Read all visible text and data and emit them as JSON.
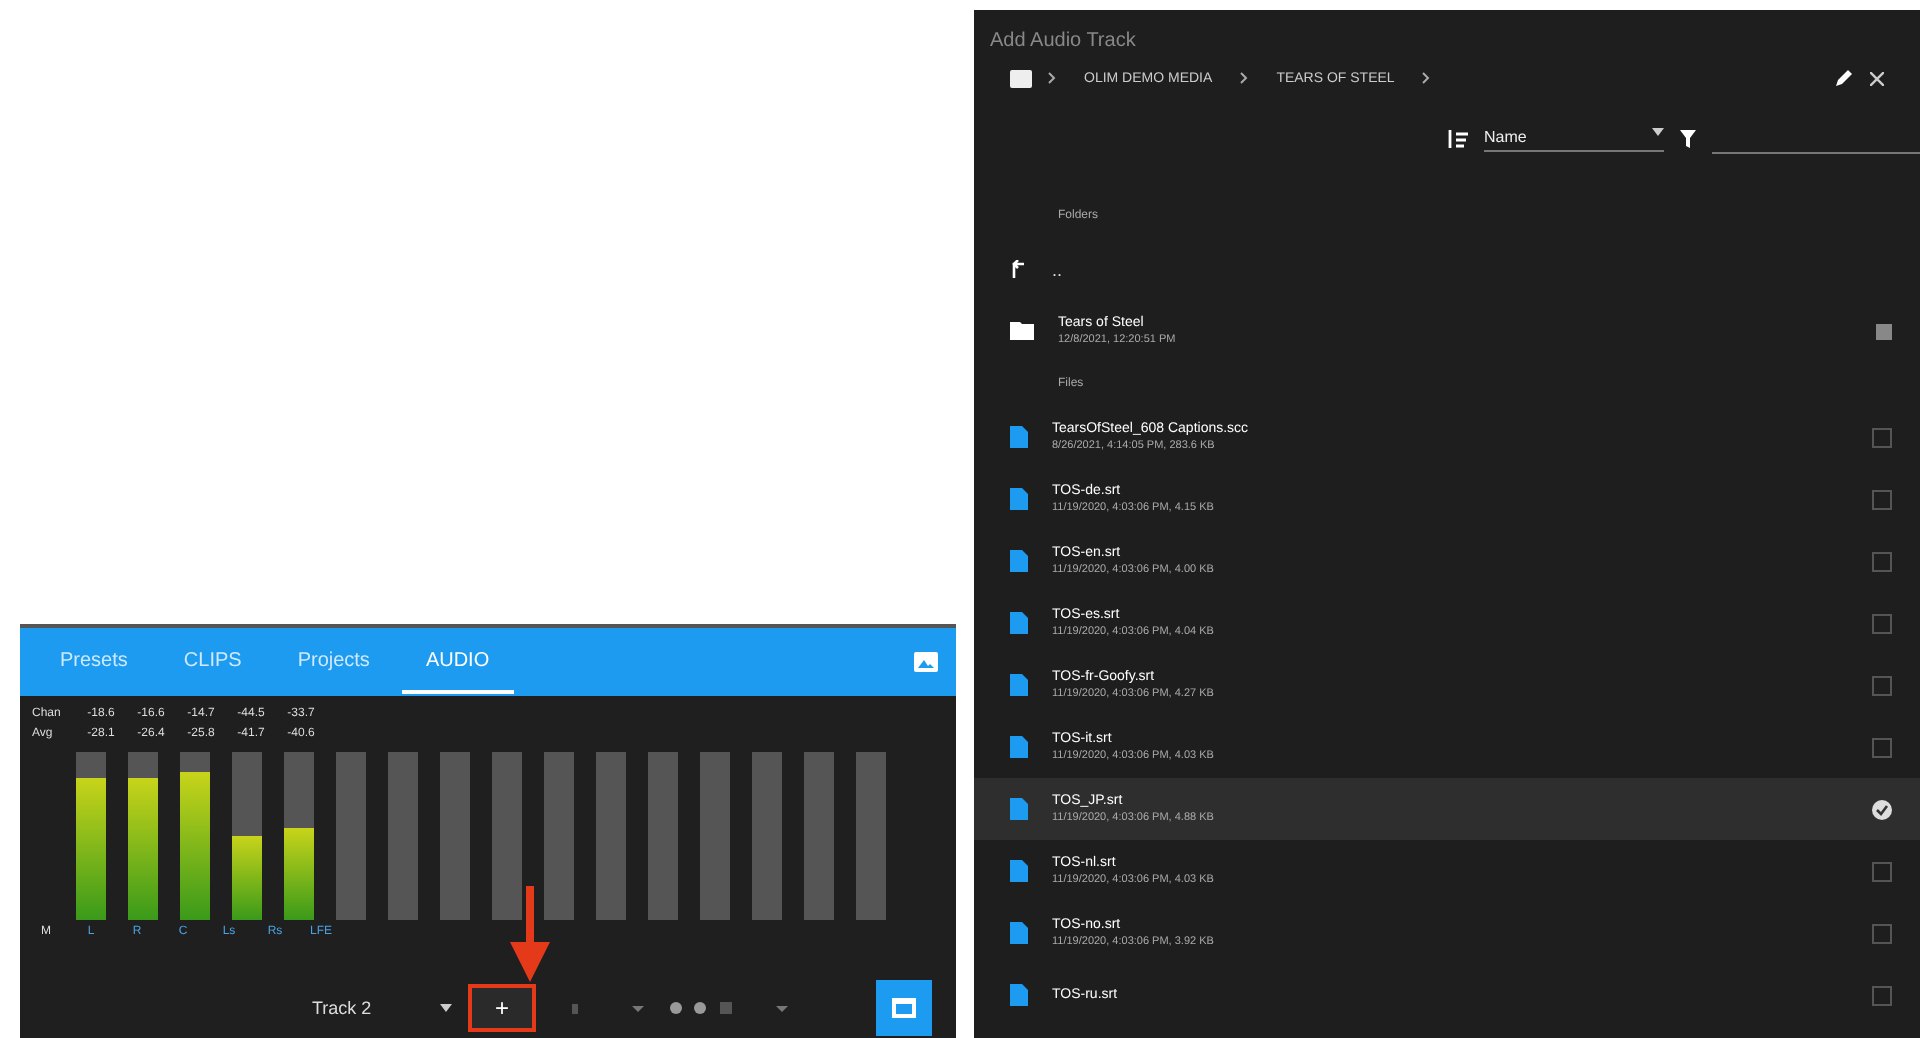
{
  "mixer": {
    "tabs": [
      {
        "label": "Presets",
        "selected": false
      },
      {
        "label": "CLIPS",
        "selected": false
      },
      {
        "label": "Projects",
        "selected": false
      },
      {
        "label": "AUDIO",
        "selected": true
      }
    ],
    "readouts": [
      {
        "label": "Chan",
        "values": [
          "-18.6",
          "-16.6",
          "-14.7",
          "-44.5",
          "-33.7"
        ]
      },
      {
        "label": "Avg",
        "values": [
          "-28.1",
          "-26.4",
          "-25.8",
          "-41.7",
          "-40.6"
        ]
      }
    ],
    "scale_label": "M",
    "meters": [
      {
        "kind": "active",
        "label": "L",
        "level": 0.85
      },
      {
        "kind": "active",
        "label": "R",
        "level": 0.85
      },
      {
        "kind": "active",
        "label": "C",
        "level": 0.88
      },
      {
        "kind": "active",
        "label": "Ls",
        "level": 0.5
      },
      {
        "kind": "active",
        "label": "Rs",
        "level": 0.55
      },
      {
        "kind": "inactive",
        "label": "LFE"
      },
      {
        "kind": "inactive"
      },
      {
        "kind": "inactive"
      },
      {
        "kind": "inactive"
      },
      {
        "kind": "inactive"
      },
      {
        "kind": "inactive"
      },
      {
        "kind": "inactive"
      },
      {
        "kind": "inactive"
      },
      {
        "kind": "inactive"
      },
      {
        "kind": "inactive"
      },
      {
        "kind": "inactive"
      }
    ],
    "track_select": "Track 2",
    "add_button": "+"
  },
  "dialog": {
    "title": "Add Audio Track",
    "breadcrumbs": [
      "OLIM DEMO MEDIA",
      "TEARS OF STEEL"
    ],
    "sort": "Name",
    "folders_heading": "Folders",
    "up_item": "..",
    "folders": [
      {
        "name": "Tears of Steel",
        "meta": "12/8/2021, 12:20:51 PM"
      }
    ],
    "files_heading": "Files",
    "files": [
      {
        "name": "TearsOfSteel_608 Captions.scc",
        "meta": "8/26/2021, 4:14:05 PM, 283.6 KB",
        "checked": false
      },
      {
        "name": "TOS-de.srt",
        "meta": "11/19/2020, 4:03:06 PM, 4.15 KB",
        "checked": false
      },
      {
        "name": "TOS-en.srt",
        "meta": "11/19/2020, 4:03:06 PM, 4.00 KB",
        "checked": false
      },
      {
        "name": "TOS-es.srt",
        "meta": "11/19/2020, 4:03:06 PM, 4.04 KB",
        "checked": false
      },
      {
        "name": "TOS-fr-Goofy.srt",
        "meta": "11/19/2020, 4:03:06 PM, 4.27 KB",
        "checked": false
      },
      {
        "name": "TOS-it.srt",
        "meta": "11/19/2020, 4:03:06 PM, 4.03 KB",
        "checked": false
      },
      {
        "name": "TOS_JP.srt",
        "meta": "11/19/2020, 4:03:06 PM, 4.88 KB",
        "checked": true
      },
      {
        "name": "TOS-nl.srt",
        "meta": "11/19/2020, 4:03:06 PM, 4.03 KB",
        "checked": false
      },
      {
        "name": "TOS-no.srt",
        "meta": "11/19/2020, 4:03:06 PM, 3.92 KB",
        "checked": false
      },
      {
        "name": "TOS-ru.srt",
        "checked": false
      }
    ]
  }
}
